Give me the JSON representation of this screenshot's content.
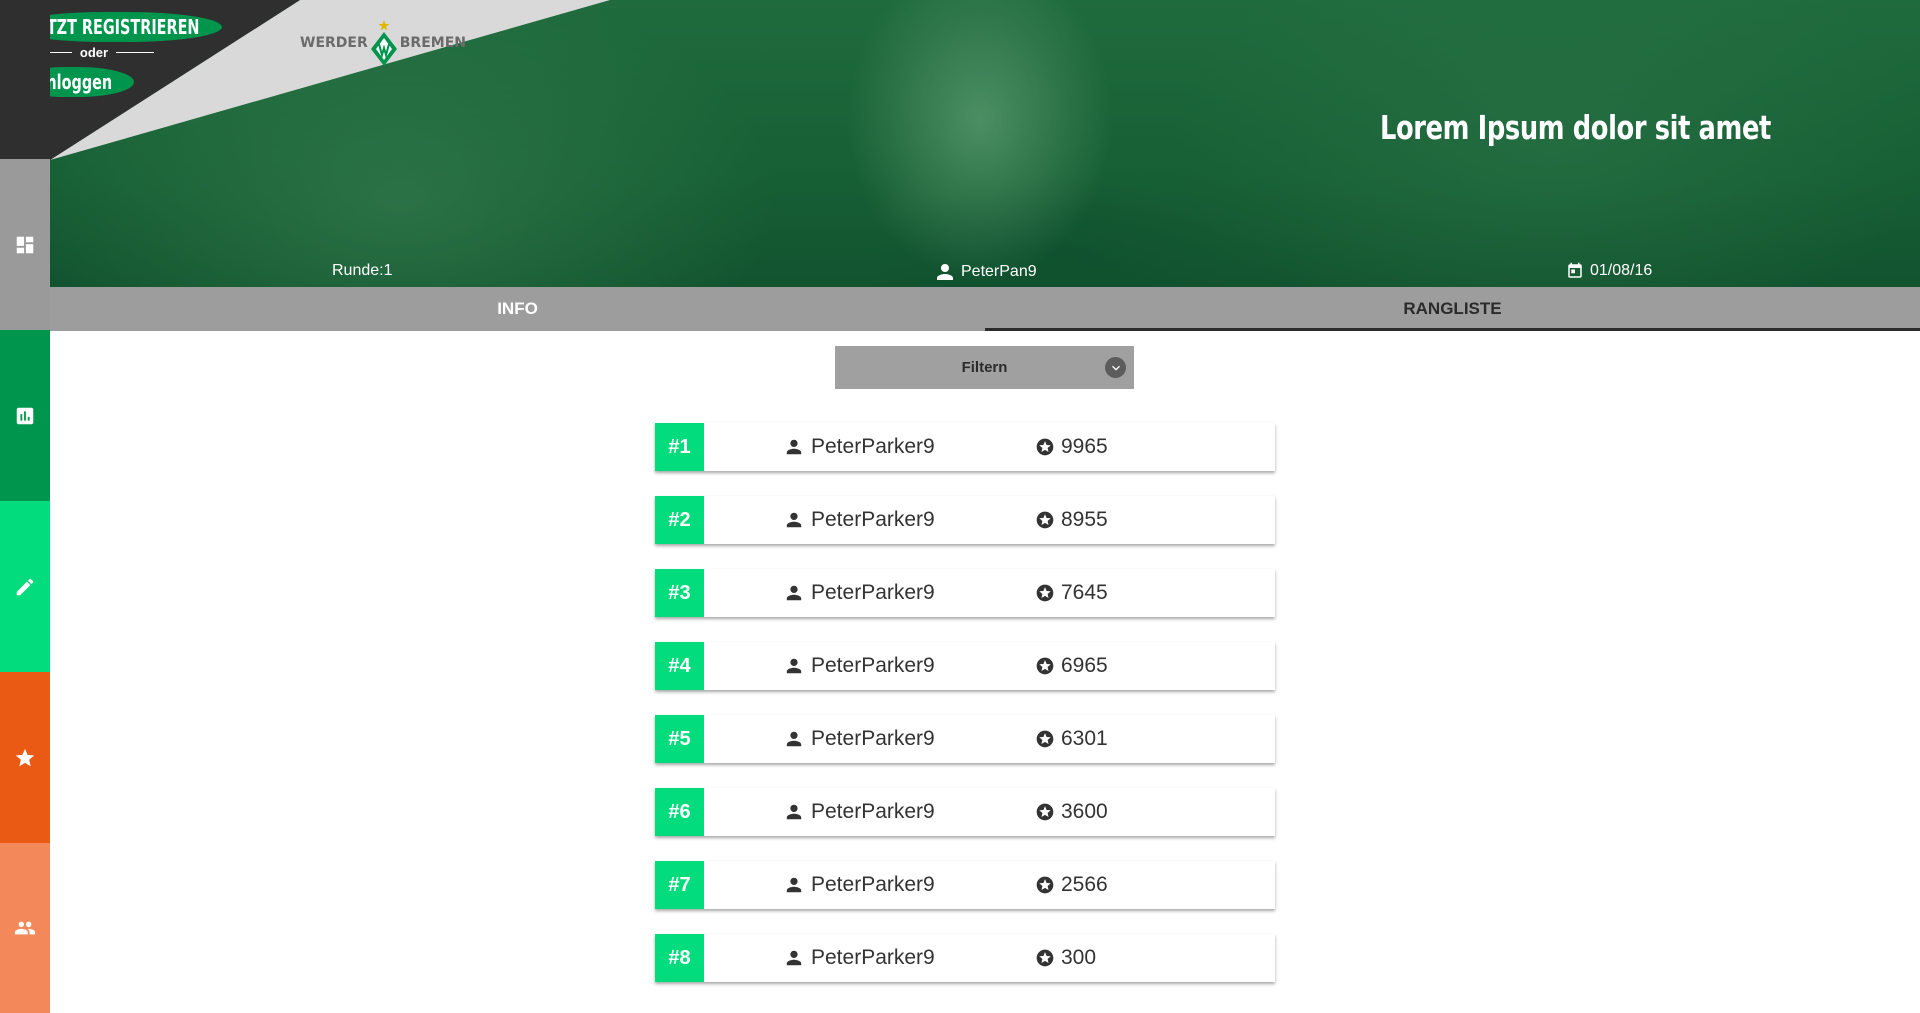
{
  "auth": {
    "register_label": "JETZT REGISTRIEREN",
    "or_label": "oder",
    "login_label": "Einloggen"
  },
  "brand": {
    "left": "WERDER",
    "right": "BREMEN"
  },
  "hero": {
    "title": "Lorem Ipsum dolor sit amet",
    "round": "Runde:1",
    "user": "PeterPan9",
    "date": "01/08/16"
  },
  "sidebar": {
    "items": [
      {
        "icon": "dashboard-icon",
        "color": "#9a9a9a"
      },
      {
        "icon": "bar-chart-icon",
        "color": "#00954c"
      },
      {
        "icon": "pencil-icon",
        "color": "#03dc7c"
      },
      {
        "icon": "star-icon",
        "color": "#ea5a14"
      },
      {
        "icon": "group-icon",
        "color": "#f3895a"
      }
    ]
  },
  "tabs": [
    {
      "label": "INFO"
    },
    {
      "label": "RANGLISTE"
    }
  ],
  "filter": {
    "label": "Filtern"
  },
  "ranking": [
    {
      "rank": "#1",
      "user": "PeterParker9",
      "score": "9965"
    },
    {
      "rank": "#2",
      "user": "PeterParker9",
      "score": "8955"
    },
    {
      "rank": "#3",
      "user": "PeterParker9",
      "score": "7645"
    },
    {
      "rank": "#4",
      "user": "PeterParker9",
      "score": "6965"
    },
    {
      "rank": "#5",
      "user": "PeterParker9",
      "score": "6301"
    },
    {
      "rank": "#6",
      "user": "PeterParker9",
      "score": "3600"
    },
    {
      "rank": "#7",
      "user": "PeterParker9",
      "score": "2566"
    },
    {
      "rank": "#8",
      "user": "PeterParker9",
      "score": "300"
    }
  ],
  "colors": {
    "accent_green": "#03dc7c",
    "brand_green": "#00954c",
    "orange": "#ea5a14",
    "light_orange": "#f3895a"
  }
}
